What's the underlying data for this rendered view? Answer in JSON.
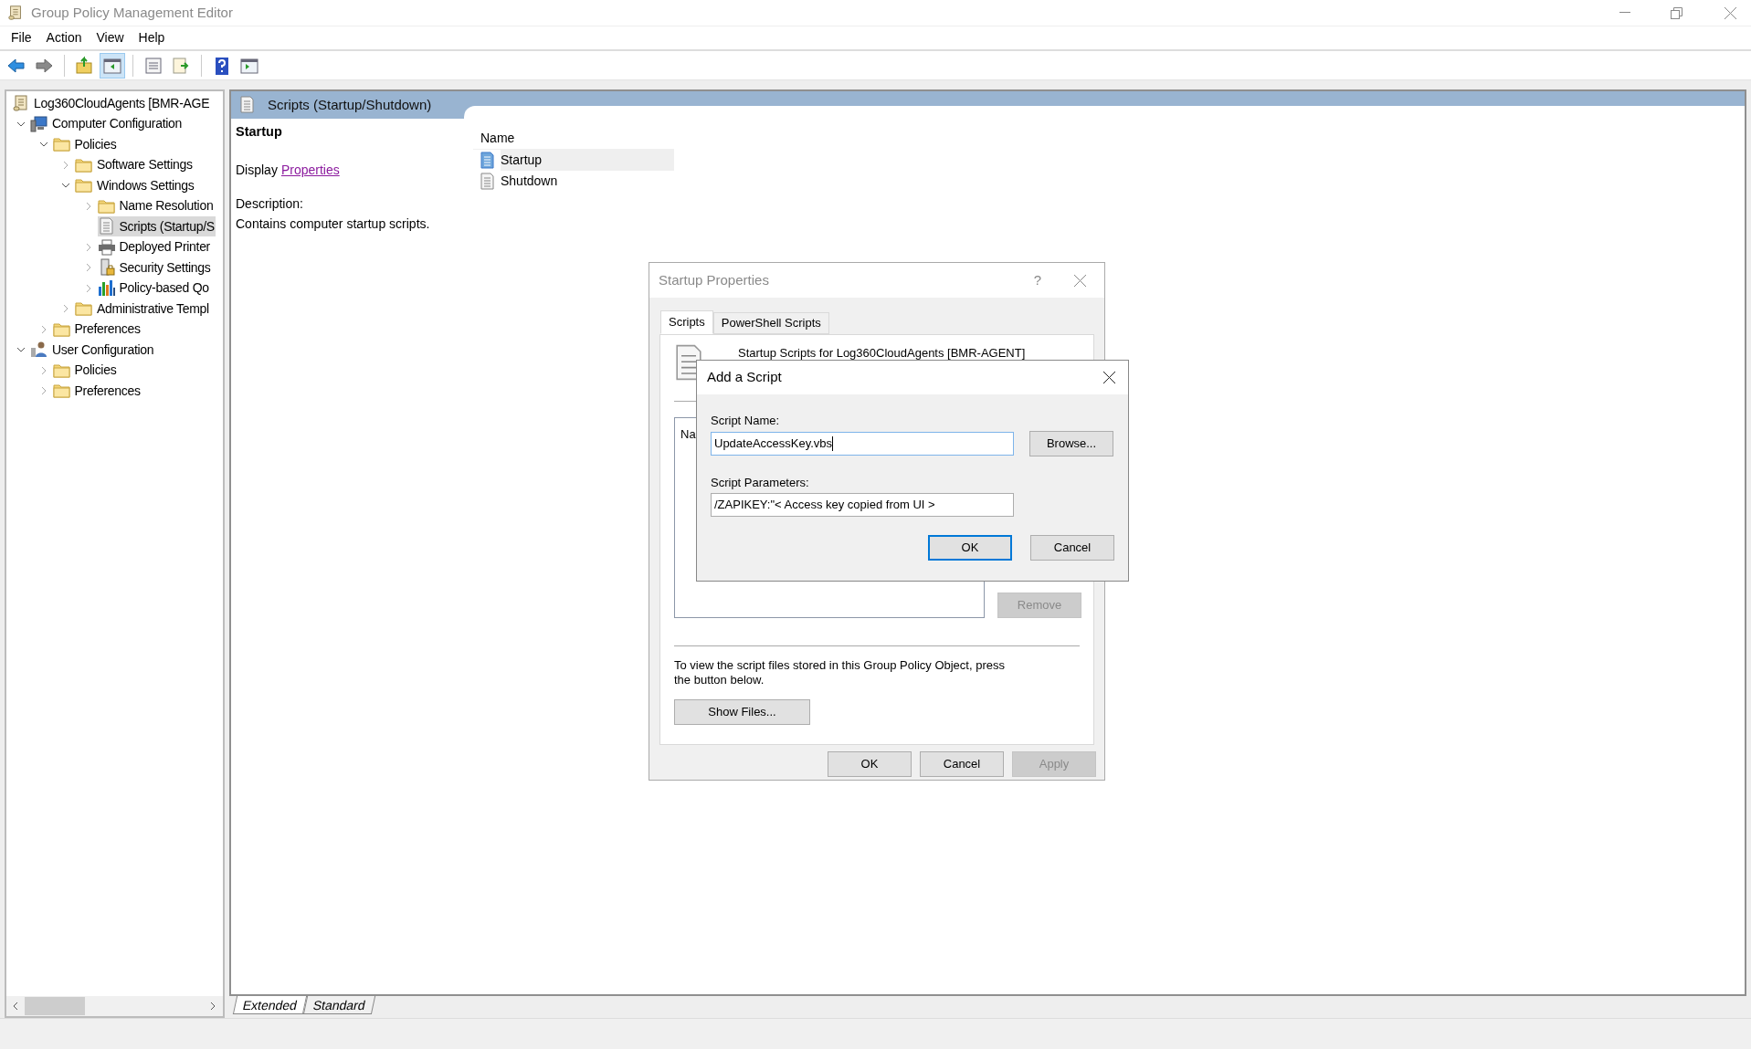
{
  "window": {
    "title": "Group Policy Management Editor"
  },
  "menu": [
    "File",
    "Action",
    "View",
    "Help"
  ],
  "toolbar": [
    {
      "kind": "back",
      "selected": false
    },
    {
      "kind": "forward",
      "selected": false
    },
    {
      "kind": "sep"
    },
    {
      "kind": "up",
      "selected": false
    },
    {
      "kind": "tree",
      "selected": true
    },
    {
      "kind": "sep"
    },
    {
      "kind": "properties",
      "selected": false
    },
    {
      "kind": "export",
      "selected": false
    },
    {
      "kind": "sep"
    },
    {
      "kind": "help",
      "selected": false
    },
    {
      "kind": "actionpane",
      "selected": false
    }
  ],
  "tree": [
    {
      "label": "Log360CloudAgents [BMR-AGE",
      "kind": "gpo",
      "selected": false,
      "children": [
        {
          "label": "Computer Configuration",
          "kind": "computer",
          "expanded": true,
          "selected": false,
          "children": [
            {
              "label": "Policies",
              "kind": "folder",
              "expanded": true,
              "selected": false,
              "children": [
                {
                  "label": "Software Settings",
                  "kind": "folder",
                  "expanded": false,
                  "selected": false
                },
                {
                  "label": "Windows Settings",
                  "kind": "folder",
                  "expanded": true,
                  "selected": false,
                  "children": [
                    {
                      "label": "Name Resolution",
                      "kind": "folder",
                      "expanded": false,
                      "selected": false
                    },
                    {
                      "label": "Scripts (Startup/S",
                      "kind": "scripts",
                      "selected": true
                    },
                    {
                      "label": "Deployed Printer",
                      "kind": "printer",
                      "expanded": false,
                      "selected": false
                    },
                    {
                      "label": "Security Settings",
                      "kind": "security",
                      "expanded": false,
                      "selected": false
                    },
                    {
                      "label": "Policy-based Qo",
                      "kind": "qos",
                      "expanded": false,
                      "selected": false
                    }
                  ]
                },
                {
                  "label": "Administrative Templ",
                  "kind": "folder",
                  "expanded": false,
                  "selected": false
                }
              ]
            },
            {
              "label": "Preferences",
              "kind": "folder",
              "expanded": false,
              "selected": false
            }
          ]
        },
        {
          "label": "User Configuration",
          "kind": "user",
          "expanded": true,
          "selected": false,
          "children": [
            {
              "label": "Policies",
              "kind": "folder",
              "expanded": false,
              "selected": false
            },
            {
              "label": "Preferences",
              "kind": "folder",
              "expanded": false,
              "selected": false
            }
          ]
        }
      ]
    }
  ],
  "details": {
    "title": "Scripts (Startup/Shutdown)",
    "heading": "Startup",
    "display_label": "Display",
    "link": "Properties",
    "description_label": "Description:",
    "description": "Contains computer startup scripts."
  },
  "list": {
    "column": "Name",
    "items": [
      {
        "label": "Startup",
        "selected": true
      },
      {
        "label": "Shutdown",
        "selected": false
      }
    ]
  },
  "view_tabs": [
    {
      "label": "Extended",
      "selected": true
    },
    {
      "label": "Standard",
      "selected": false
    }
  ],
  "startup_dialog": {
    "title": "Startup Properties",
    "help": "?",
    "tabs": [
      {
        "label": "Scripts",
        "selected": true
      },
      {
        "label": "PowerShell Scripts",
        "selected": false
      }
    ],
    "header": "Startup Scripts for Log360CloudAgents [BMR-AGENT]",
    "list_column": "Na",
    "remove": {
      "label": "Remove",
      "disabled": true
    },
    "info": "To view the script files stored in this Group Policy Object, press the button below.",
    "show_files": "Show Files...",
    "buttons": [
      {
        "label": "OK",
        "disabled": false
      },
      {
        "label": "Cancel",
        "disabled": false
      },
      {
        "label": "Apply",
        "disabled": true
      }
    ]
  },
  "add_dialog": {
    "title": "Add a Script",
    "name_label": "Script Name:",
    "name_value": "UpdateAccessKey.vbs",
    "browse": "Browse...",
    "params_label": "Script Parameters:",
    "params_value": "/ZAPIKEY:\"< Access key copied from UI >",
    "buttons": [
      {
        "label": "OK",
        "default": true
      },
      {
        "label": "Cancel",
        "default": false
      }
    ]
  }
}
